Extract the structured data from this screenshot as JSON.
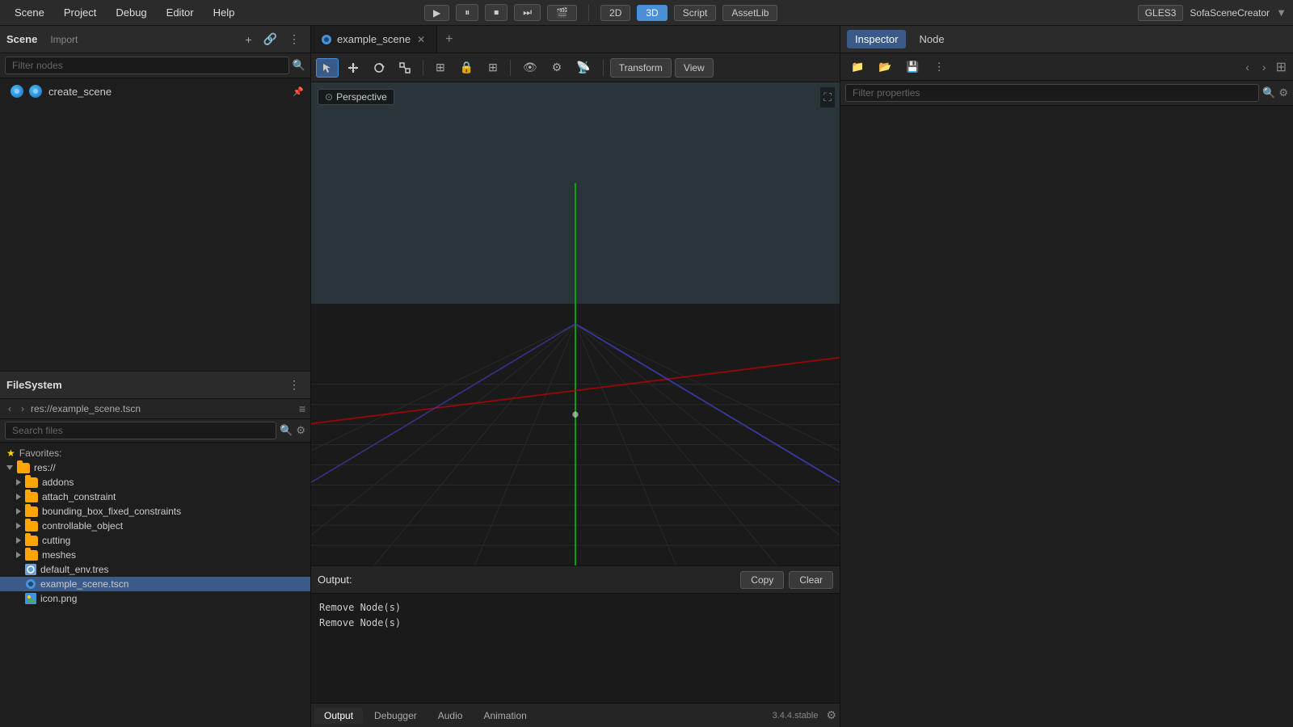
{
  "menubar": {
    "items": [
      "Scene",
      "Project",
      "Debug",
      "Editor",
      "Help"
    ],
    "toolbar_center": {
      "btn_2d": "2D",
      "btn_3d": "3D",
      "btn_script": "Script",
      "btn_assetlib": "AssetLib"
    },
    "toolbar_right": {
      "gles": "GLES3",
      "user": "SofaSceneCreator"
    }
  },
  "scene_panel": {
    "title": "Scene",
    "import_label": "Import",
    "filter_placeholder": "Filter nodes",
    "tree": [
      {
        "id": "create_scene",
        "label": "create_scene",
        "level": 0,
        "has_icon": true
      }
    ]
  },
  "filesystem_panel": {
    "title": "FileSystem",
    "breadcrumb": "res://example_scene.tscn",
    "search_placeholder": "Search files",
    "favorites_label": "Favorites:",
    "items": [
      {
        "id": "res",
        "label": "res://",
        "type": "folder",
        "level": 0,
        "expanded": true
      },
      {
        "id": "addons",
        "label": "addons",
        "type": "folder",
        "level": 1,
        "expanded": false
      },
      {
        "id": "attach_constraint",
        "label": "attach_constraint",
        "type": "folder",
        "level": 1,
        "expanded": false
      },
      {
        "id": "bounding_box",
        "label": "bounding_box_fixed_constraints",
        "type": "folder",
        "level": 1,
        "expanded": false
      },
      {
        "id": "controllable_object",
        "label": "controllable_object",
        "type": "folder",
        "level": 1,
        "expanded": false
      },
      {
        "id": "cutting",
        "label": "cutting",
        "type": "folder",
        "level": 1,
        "expanded": false
      },
      {
        "id": "meshes",
        "label": "meshes",
        "type": "folder",
        "level": 1,
        "expanded": false
      },
      {
        "id": "default_env",
        "label": "default_env.tres",
        "type": "tres",
        "level": 1
      },
      {
        "id": "example_scene",
        "label": "example_scene.tscn",
        "type": "tscn",
        "level": 1,
        "selected": true
      },
      {
        "id": "icon",
        "label": "icon.png",
        "type": "png",
        "level": 1
      }
    ]
  },
  "viewport": {
    "tab_name": "example_scene",
    "perspective_label": "Perspective",
    "transform_btn": "Transform",
    "view_btn": "View"
  },
  "output_panel": {
    "label": "Output:",
    "copy_btn": "Copy",
    "clear_btn": "Clear",
    "lines": [
      "Remove Node(s)",
      "Remove Node(s)"
    ],
    "tabs": [
      "Output",
      "Debugger",
      "Audio",
      "Animation"
    ],
    "active_tab": "Output",
    "version": "3.4.4.stable"
  },
  "inspector": {
    "title": "Inspector",
    "tabs": [
      "Inspector",
      "Node"
    ],
    "active_tab": "Inspector",
    "filter_placeholder": "Filter properties"
  }
}
